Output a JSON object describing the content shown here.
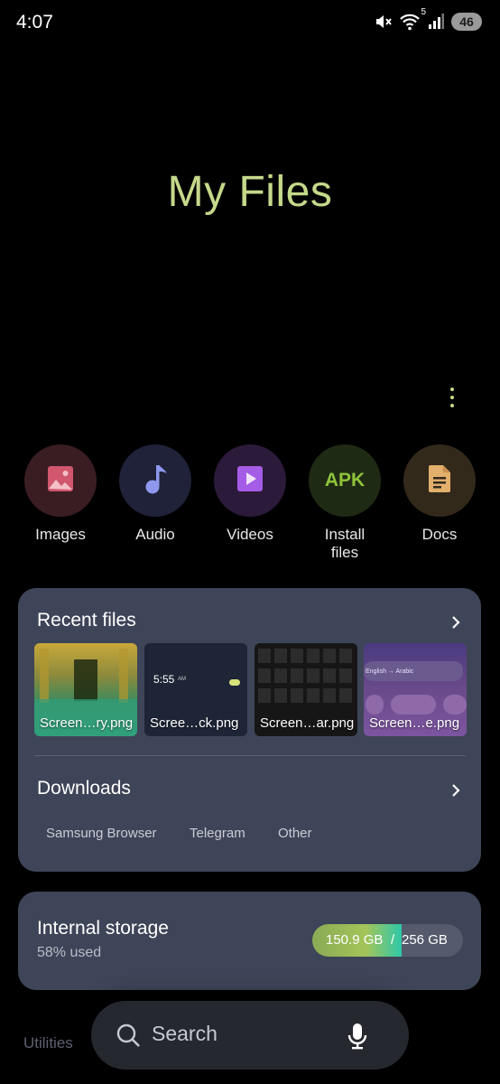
{
  "status_bar": {
    "time": "4:07",
    "wifi_label": "5",
    "battery": "46"
  },
  "page_title": "My Files",
  "categories": [
    {
      "label": "Images",
      "icon": "image-icon",
      "color": "#d0576d",
      "bg": "#3a1d23"
    },
    {
      "label": "Audio",
      "icon": "music-note-icon",
      "color": "#8f98ee",
      "bg": "#1f2238"
    },
    {
      "label": "Videos",
      "icon": "play-icon",
      "color": "#a55ce6",
      "bg": "#2c1a3a"
    },
    {
      "label": "Install\nfiles",
      "label_line1": "Install",
      "label_line2": "files",
      "icon": "apk-icon",
      "icon_text": "APK",
      "color": "#8ec43a",
      "bg": "#1f2a14"
    },
    {
      "label": "Docs",
      "icon": "document-icon",
      "color": "#e2b06c",
      "bg": "#33291b"
    }
  ],
  "recent": {
    "heading": "Recent files",
    "files": [
      {
        "name": "Screen…ry.png"
      },
      {
        "name": "Scree…ck.png",
        "overlay_time": "5:55",
        "overlay_ampm": "AM"
      },
      {
        "name": "Screen…ar.png"
      },
      {
        "name": "Screen…e.png",
        "overlay_text": "English → Arabic"
      }
    ]
  },
  "downloads": {
    "heading": "Downloads",
    "sources": [
      "Samsung Browser",
      "Telegram",
      "Other"
    ]
  },
  "storage": {
    "title": "Internal storage",
    "used_percent_text": "58% used",
    "used": "150.9 GB",
    "separator": "/",
    "total": "256 GB",
    "fill_fraction": 0.59
  },
  "utilities_label": "Utilities",
  "search": {
    "placeholder": "Search"
  },
  "colors": {
    "accent": "#c5d98a",
    "card_bg": "#3f4558",
    "search_bg": "#26282f"
  }
}
